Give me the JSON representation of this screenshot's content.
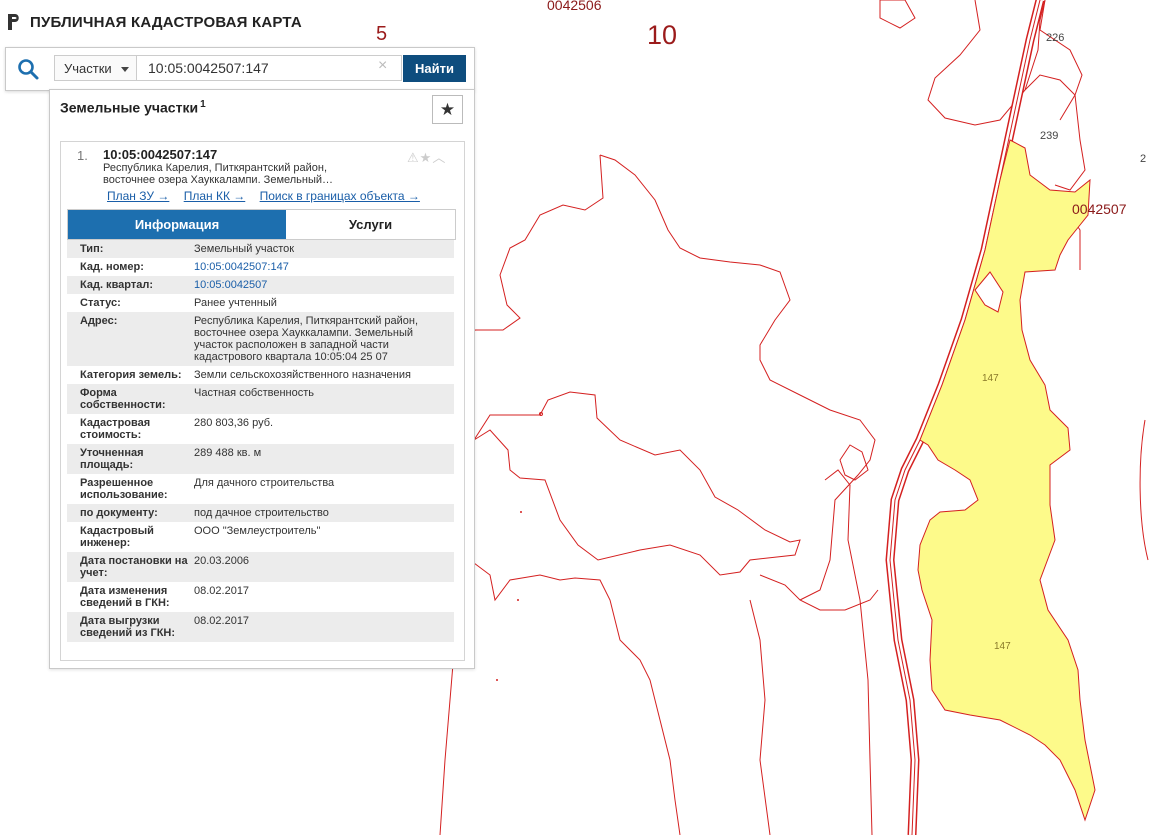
{
  "app": {
    "title": "ПУБЛИЧНАЯ КАДАСТРОВАЯ КАРТА"
  },
  "search": {
    "filter": "Участки",
    "value": "10:05:0042507:147",
    "button": "Найти"
  },
  "panel": {
    "title": "Земельные участки",
    "count": "1",
    "result": {
      "index": "1.",
      "number": "10:05:0042507:147",
      "address_short": "Республика Карелия, Питкярантский район, восточнее озера Хауккалампи. Земельный…",
      "links": [
        "План ЗУ →",
        "План КК →",
        "Поиск в границах объекта →"
      ],
      "tabs": [
        "Информация",
        "Услуги"
      ],
      "info": [
        {
          "label": "Тип:",
          "value": "Земельный участок"
        },
        {
          "label": "Кад. номер:",
          "value": "10:05:0042507:147"
        },
        {
          "label": "Кад. квартал:",
          "value": "10:05:0042507"
        },
        {
          "label": "Статус:",
          "value": "Ранее учтенный"
        },
        {
          "label": "Адрес:",
          "value": "Республика Карелия, Питкярантский район, восточнее озера Хауккалампи. Земельный участок расположен в западной части кадастрового квартала 10:05:04 25 07"
        },
        {
          "label": "Категория земель:",
          "value": "Земли сельскохозяйственного назначения"
        },
        {
          "label": "Форма собственности:",
          "value": "Частная собственность"
        },
        {
          "label": "Кадастровая стоимость:",
          "value": "280 803,36 руб."
        },
        {
          "label": "Уточненная площадь:",
          "value": "289 488 кв. м"
        },
        {
          "label": "Разрешенное использование:",
          "value": "Для дачного строительства"
        },
        {
          "label": "по документу:",
          "value": "под дачное строительство"
        },
        {
          "label": "Кадастровый инженер:",
          "value": "ООО \"Землеустроитель\""
        },
        {
          "label": "Дата постановки на учет:",
          "value": "20.03.2006"
        },
        {
          "label": "Дата изменения сведений в ГКН:",
          "value": "08.02.2017"
        },
        {
          "label": "Дата выгрузки сведений из ГКН:",
          "value": "08.02.2017"
        }
      ]
    }
  },
  "map": {
    "labels": {
      "l5": "5",
      "l10": "10",
      "q0042506": "0042506",
      "q0042507": "0042507",
      "p226": "226",
      "p239": "239",
      "p147a": "147",
      "p147b": "147",
      "p2": "2"
    },
    "colors": {
      "boundary": "#d42020",
      "parcel_fill": "#fdfa8a"
    }
  }
}
